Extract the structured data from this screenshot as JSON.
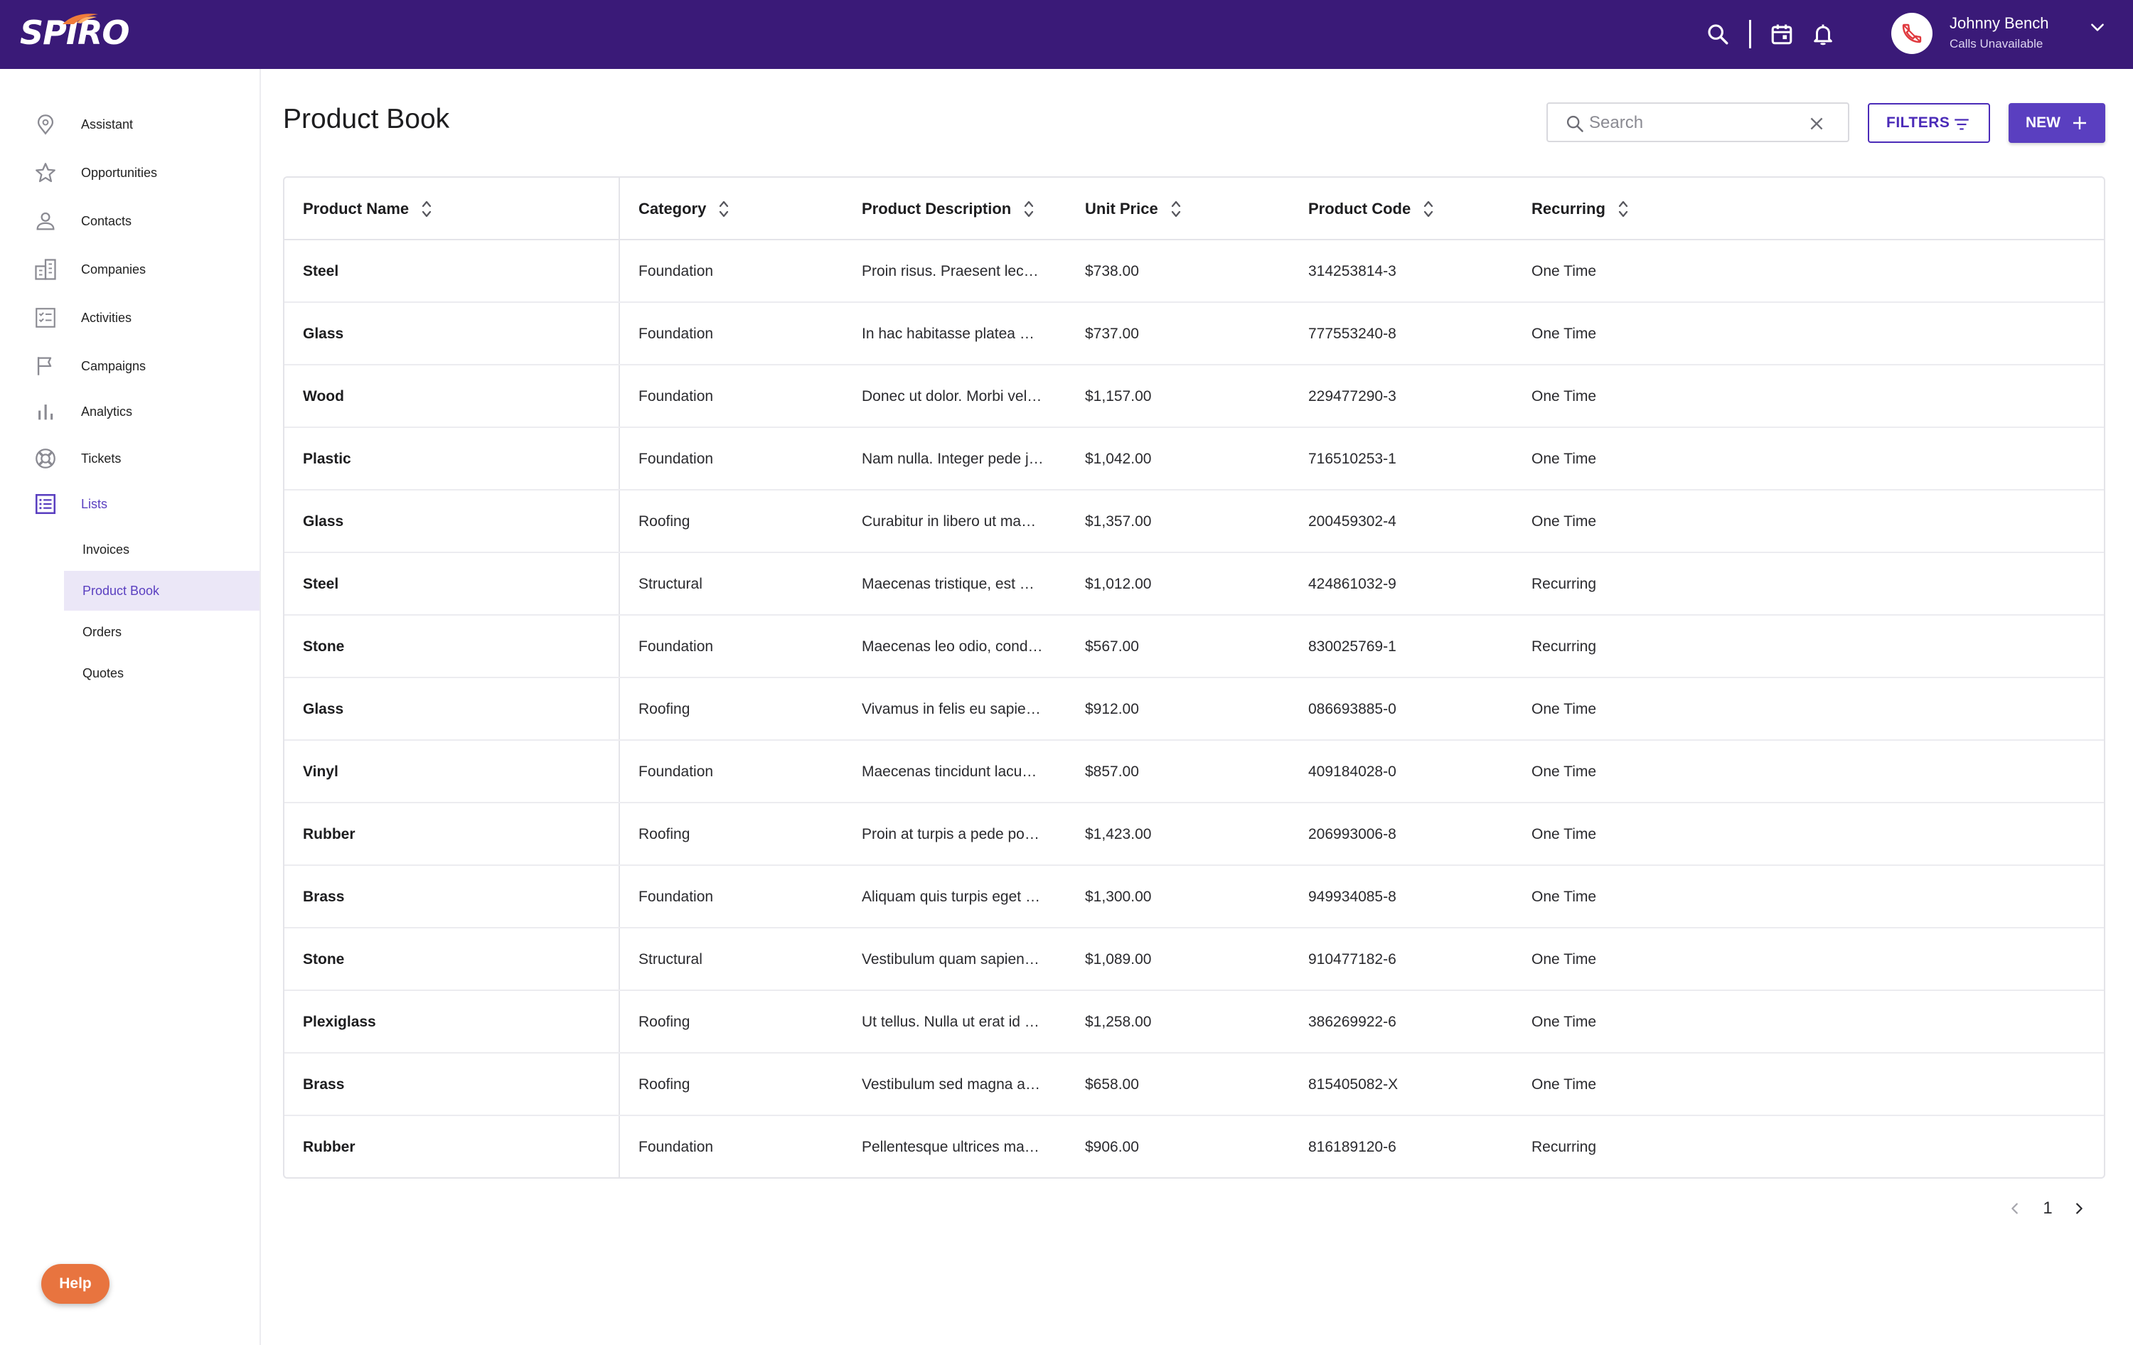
{
  "brand": {
    "logo_text": "SPIRO"
  },
  "topbar": {
    "icons": [
      "search-icon",
      "calendar-icon",
      "bell-icon",
      "phone-icon",
      "chevron-down-icon"
    ],
    "user_name": "Johnny Bench",
    "user_status": "Calls Unavailable"
  },
  "sidebar": {
    "items": [
      {
        "label": "Assistant",
        "icon": "assistant-icon"
      },
      {
        "label": "Opportunities",
        "icon": "star-icon"
      },
      {
        "label": "Contacts",
        "icon": "person-icon"
      },
      {
        "label": "Companies",
        "icon": "building-icon"
      },
      {
        "label": "Activities",
        "icon": "checklist-icon"
      },
      {
        "label": "Campaigns",
        "icon": "flag-icon"
      },
      {
        "label": "Analytics",
        "icon": "bar-chart-icon"
      },
      {
        "label": "Tickets",
        "icon": "lifebuoy-icon"
      },
      {
        "label": "Lists",
        "icon": "list-icon"
      }
    ],
    "active_item": "Lists",
    "sub_items": [
      {
        "label": "Invoices"
      },
      {
        "label": "Product Book"
      },
      {
        "label": "Orders"
      },
      {
        "label": "Quotes"
      }
    ],
    "selected_sub_item": "Product Book",
    "help_label": "Help"
  },
  "main": {
    "title": "Product Book",
    "search": {
      "placeholder": "Search",
      "value": ""
    },
    "filters_label": "FILTERS",
    "new_label": "NEW",
    "accent_color": "#5a3fc0",
    "header_color": "#3a1a78"
  },
  "table": {
    "columns": [
      "Product Name",
      "Category",
      "Product Description",
      "Unit Price",
      "Product Code",
      "Recurring"
    ],
    "rows": [
      [
        "Steel",
        "Foundation",
        "Proin risus. Praesent lec…",
        "$738.00",
        "314253814-3",
        "One Time"
      ],
      [
        "Glass",
        "Foundation",
        "In hac habitasse platea …",
        "$737.00",
        "777553240-8",
        "One Time"
      ],
      [
        "Wood",
        "Foundation",
        "Donec ut dolor. Morbi vel…",
        "$1,157.00",
        "229477290-3",
        "One Time"
      ],
      [
        "Plastic",
        "Foundation",
        "Nam nulla. Integer pede j…",
        "$1,042.00",
        "716510253-1",
        "One Time"
      ],
      [
        "Glass",
        "Roofing",
        "Curabitur in libero ut ma…",
        "$1,357.00",
        "200459302-4",
        "One Time"
      ],
      [
        "Steel",
        "Structural",
        "Maecenas tristique, est …",
        "$1,012.00",
        "424861032-9",
        "Recurring"
      ],
      [
        "Stone",
        "Foundation",
        "Maecenas leo odio, cond…",
        "$567.00",
        "830025769-1",
        "Recurring"
      ],
      [
        "Glass",
        "Roofing",
        "Vivamus in felis eu sapie…",
        "$912.00",
        "086693885-0",
        "One Time"
      ],
      [
        "Vinyl",
        "Foundation",
        "Maecenas tincidunt lacu…",
        "$857.00",
        "409184028-0",
        "One Time"
      ],
      [
        "Rubber",
        "Roofing",
        "Proin at turpis a pede po…",
        "$1,423.00",
        "206993006-8",
        "One Time"
      ],
      [
        "Brass",
        "Foundation",
        "Aliquam quis turpis eget …",
        "$1,300.00",
        "949934085-8",
        "One Time"
      ],
      [
        "Stone",
        "Structural",
        "Vestibulum quam sapien…",
        "$1,089.00",
        "910477182-6",
        "One Time"
      ],
      [
        "Plexiglass",
        "Roofing",
        "Ut tellus. Nulla ut erat id …",
        "$1,258.00",
        "386269922-6",
        "One Time"
      ],
      [
        "Brass",
        "Roofing",
        "Vestibulum sed magna a…",
        "$658.00",
        "815405082-X",
        "One Time"
      ],
      [
        "Rubber",
        "Foundation",
        "Pellentesque ultrices ma…",
        "$906.00",
        "816189120-6",
        "Recurring"
      ]
    ]
  },
  "pagination": {
    "current_page": "1"
  }
}
